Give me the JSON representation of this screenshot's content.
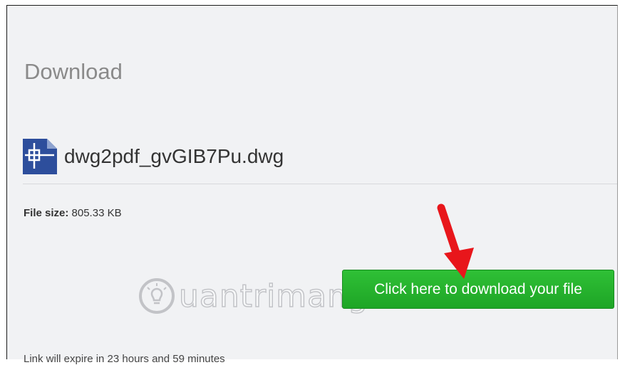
{
  "section": {
    "title": "Download"
  },
  "file": {
    "name": "dwg2pdf_gvGIB7Pu.dwg",
    "icon": "cad-file-icon"
  },
  "size": {
    "label": "File size:",
    "value": "805.33 KB"
  },
  "download": {
    "label": "Click here to download your file"
  },
  "watermark": {
    "text": "uantrimang"
  },
  "footer": {
    "text": "Link will expire in 23 hours and 59 minutes"
  },
  "colors": {
    "accent": "#22b22a",
    "arrow": "#e8161b",
    "icon": "#2d4e9c"
  }
}
